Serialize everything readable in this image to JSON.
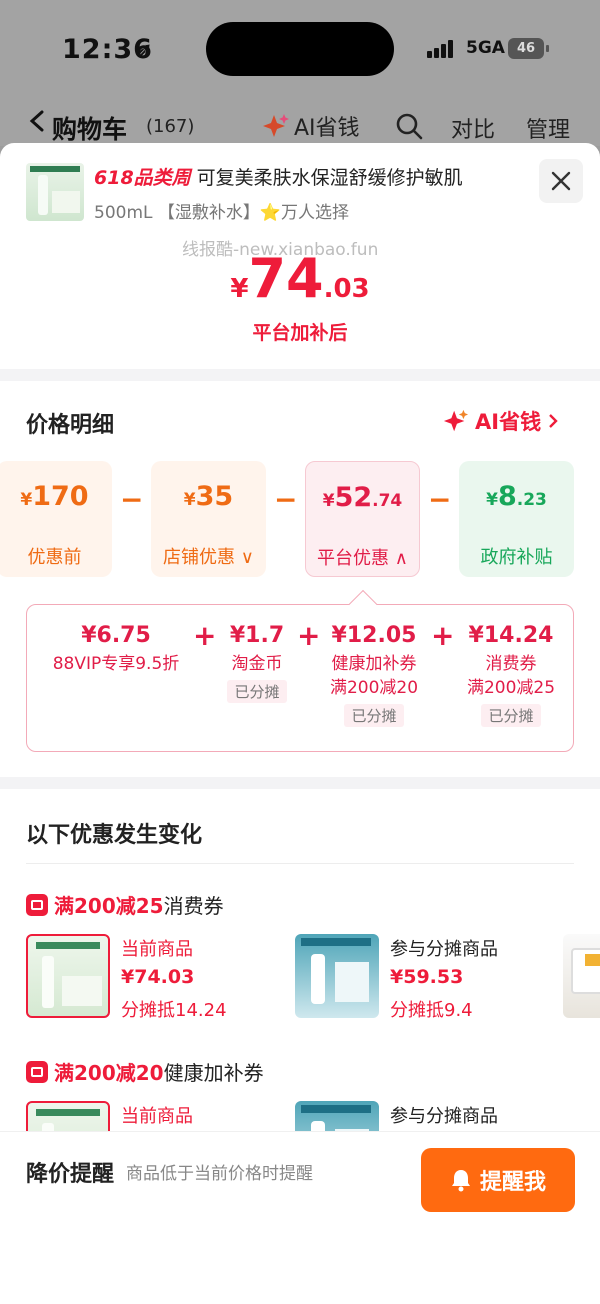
{
  "status_bar": {
    "time": "12:36",
    "network": "5GA",
    "battery": "46"
  },
  "nav": {
    "title": "购物车",
    "count": "(167)",
    "ai_label": "AI省钱",
    "compare": "对比",
    "manage": "管理"
  },
  "product": {
    "badge": "618品类周",
    "title": "可复美柔肤水保湿舒缓修护敏肌",
    "spec": "500mL 【湿敷补水】⭐万人选择",
    "watermark": "线报酷-new.xianbao.fun",
    "price_symbol": "¥",
    "price_int": "74",
    "price_dec": ".03",
    "price_caption": "平台加补后"
  },
  "detail": {
    "title": "价格明细",
    "ai_link": "AI省钱",
    "cards": [
      {
        "symbol": "¥",
        "int": "170",
        "dec": "",
        "label": "优惠前"
      },
      {
        "symbol": "¥",
        "int": "35",
        "dec": "",
        "label": "店铺优惠 ∨"
      },
      {
        "symbol": "¥",
        "int": "52",
        "dec": ".74",
        "label": "平台优惠 ∧"
      },
      {
        "symbol": "¥",
        "int": "8",
        "dec": ".23",
        "label": "政府补贴"
      }
    ],
    "breakdown": [
      {
        "amount": "¥6.75",
        "desc1": "88VIP专享9.5折",
        "desc2": "",
        "pill": ""
      },
      {
        "amount": "¥1.7",
        "desc1": "淘金币",
        "desc2": "",
        "pill": "已分摊"
      },
      {
        "amount": "¥12.05",
        "desc1": "健康加补券",
        "desc2": "满200减20",
        "pill": "已分摊"
      },
      {
        "amount": "¥14.24",
        "desc1": "消费券",
        "desc2": "满200减25",
        "pill": "已分摊"
      }
    ]
  },
  "changes": {
    "title": "以下优惠发生变化",
    "groups": [
      {
        "coupon_em": "满200减25",
        "coupon_rest": "消费券",
        "items": [
          {
            "label": "当前商品",
            "price": "¥74.03",
            "share": "分摊抵14.24"
          },
          {
            "label": "参与分摊商品",
            "price": "¥59.53",
            "share": "分摊抵9.4"
          }
        ]
      },
      {
        "coupon_em": "满200减20",
        "coupon_rest": "健康加补券",
        "items": [
          {
            "label": "当前商品"
          },
          {
            "label": "参与分摊商品"
          }
        ]
      }
    ]
  },
  "alert": {
    "title": "降价提醒",
    "desc": "商品低于当前价格时提醒",
    "button": "提醒我"
  },
  "colors": {
    "red": "#ee1c3a",
    "orange": "#ef6b14",
    "green": "#18a75a",
    "button": "#ff6a10"
  }
}
